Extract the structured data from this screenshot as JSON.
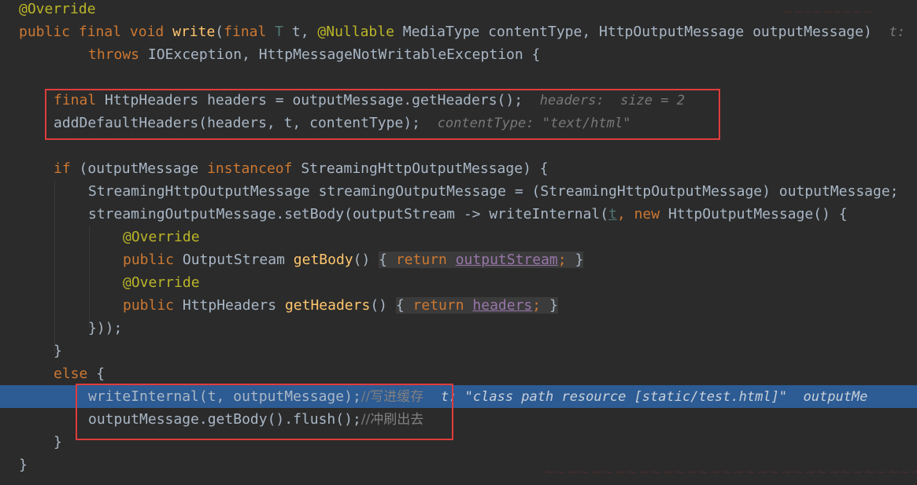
{
  "code": {
    "l1_ann": "@Override",
    "l2_public": "public",
    "l2_final": "final",
    "l2_void": "void",
    "l2_write": "write",
    "l2_final2": "final",
    "l2_T": "T",
    "l2_t": "t,",
    "l2_nullable": "@Nullable",
    "l2_rest": "MediaType contentType, HttpOutputMessage outputMessage)",
    "l2_hint": "t:",
    "l3_throws": "throws",
    "l3_rest": "IOException, HttpMessageNotWritableException {",
    "l5_final": "final",
    "l5_code": "HttpHeaders headers = outputMessage.getHeaders();",
    "l5_hint": "headers:  size = 2",
    "l6_code": "addDefaultHeaders(headers, t, contentType);",
    "l6_hint": "contentType: \"text/html\"",
    "l8_if": "if",
    "l8_a": "(outputMessage",
    "l8_instanceof": "instanceof",
    "l8_b": "StreamingHttpOutputMessage) {",
    "l9_code": "StreamingHttpOutputMessage streamingOutputMessage = (StreamingHttpOutputMessage) outputMessage;",
    "l10_a": "streamingOutputMessage.setBody(outputStream -> writeInternal(",
    "l10_t": "t",
    "l10_comma": ",",
    "l10_new": "new",
    "l10_b": "HttpOutputMessage() {",
    "l11_ann": "@Override",
    "l12_public": "public",
    "l12_type": "OutputStream",
    "l12_fn": "getBody",
    "l12_paren": "()",
    "l12_fold_open": "{",
    "l12_return": "return",
    "l12_field": "outputStream",
    "l12_semi": ";",
    "l12_fold_close": "}",
    "l13_ann": "@Override",
    "l14_public": "public",
    "l14_type": "HttpHeaders",
    "l14_fn": "getHeaders",
    "l14_paren": "()",
    "l14_fold_open": "{",
    "l14_return": "return",
    "l14_field": "headers",
    "l14_semi": ";",
    "l14_fold_close": "}",
    "l15_code": "}));",
    "l16_code": "}",
    "l17_else": "else",
    "l17_brace": "{",
    "l18_code": "writeInternal(t, outputMessage);",
    "l18_comment": "//写进缓存",
    "l18_hint": "t: \"class path resource [static/test.html]\"  outputMe",
    "l19_code": "outputMessage.getBody().flush();",
    "l19_comment": "//冲刷出去",
    "l20_code": "}",
    "l21_code": "}"
  },
  "colors": {
    "background": "#2b2b2b",
    "highlight_box": "#e03c3c",
    "execution_line": "#2d5b93"
  }
}
